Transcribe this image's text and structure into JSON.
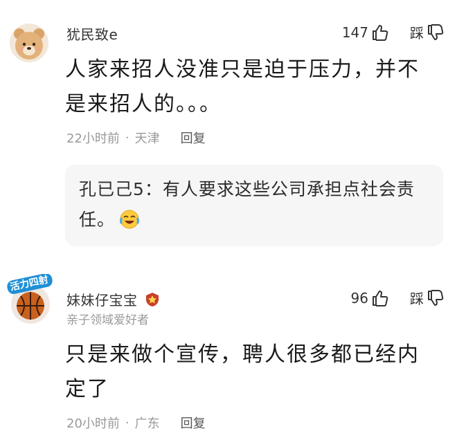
{
  "comments": [
    {
      "username": "犹民致e",
      "likes": "147",
      "dislike_label": "踩",
      "text": "人家来招人没准只是迫于压力，并不是来招人的。。。",
      "time": "22小时前",
      "separator": "·",
      "location": "天津",
      "reply_label": "回复",
      "avatar_icon": "bear-avatar-icon",
      "reply": {
        "author": "孔已己5",
        "colon": "：",
        "text": "有人要求这些公司承担点社会责任。",
        "emoji_icon": "laugh-cry-emoji-icon"
      }
    },
    {
      "username": "妹妹仔宝宝",
      "tagline": "亲子领域爱好者",
      "likes": "96",
      "dislike_label": "踩",
      "text": "只是来做个宣传，聘人很多都已经内定了",
      "time": "20小时前",
      "separator": "·",
      "location": "广东",
      "reply_label": "回复",
      "avatar_icon": "basketball-avatar-icon",
      "avatar_banner_text": "活力四射",
      "badge_icon": "creator-badge-icon"
    }
  ],
  "colors": {
    "text_primary": "#1a1a1a",
    "text_secondary": "#999999",
    "reply_bg": "#f6f6f6",
    "avatar2_banner": "#1e90d6",
    "badge": "#c8402a"
  }
}
